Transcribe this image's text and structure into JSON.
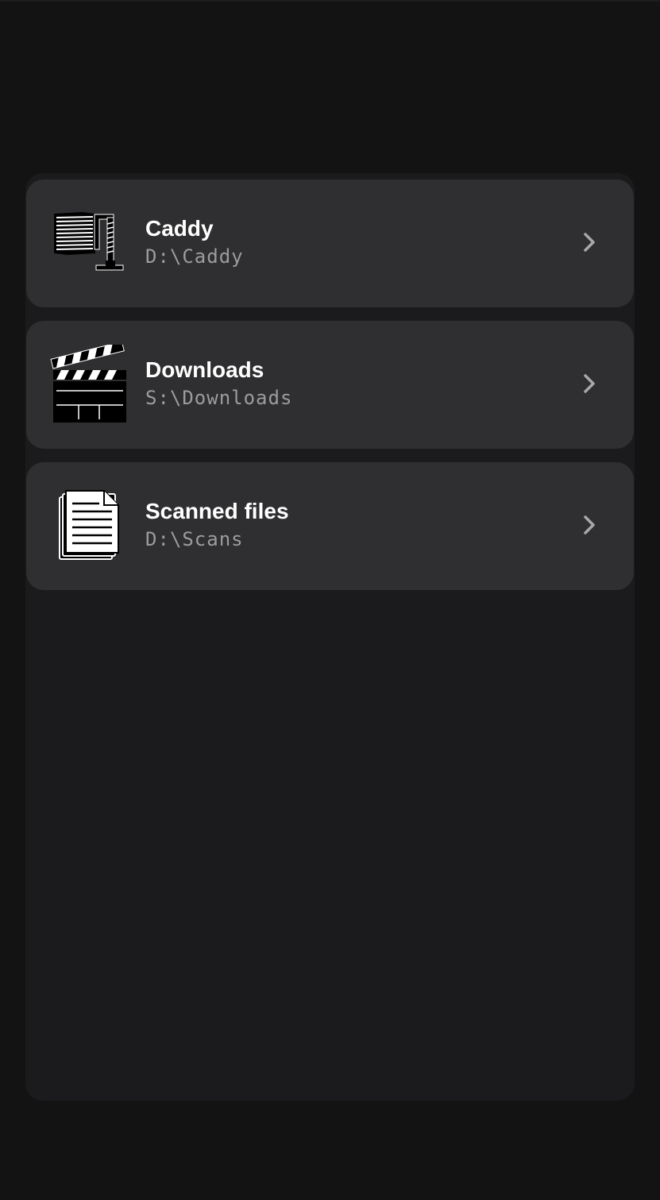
{
  "folders": [
    {
      "name": "Caddy",
      "path": "D:\\Caddy",
      "icon": "clamp-stack-icon"
    },
    {
      "name": "Downloads",
      "path": "S:\\Downloads",
      "icon": "clapperboard-icon"
    },
    {
      "name": "Scanned files",
      "path": "D:\\Scans",
      "icon": "documents-icon"
    }
  ],
  "colors": {
    "background": "#131314",
    "panel": "#1b1b1d",
    "card": "#2f2f31",
    "title": "#ffffff",
    "path": "#9c9c9f",
    "chevron": "#a8a8ab"
  }
}
